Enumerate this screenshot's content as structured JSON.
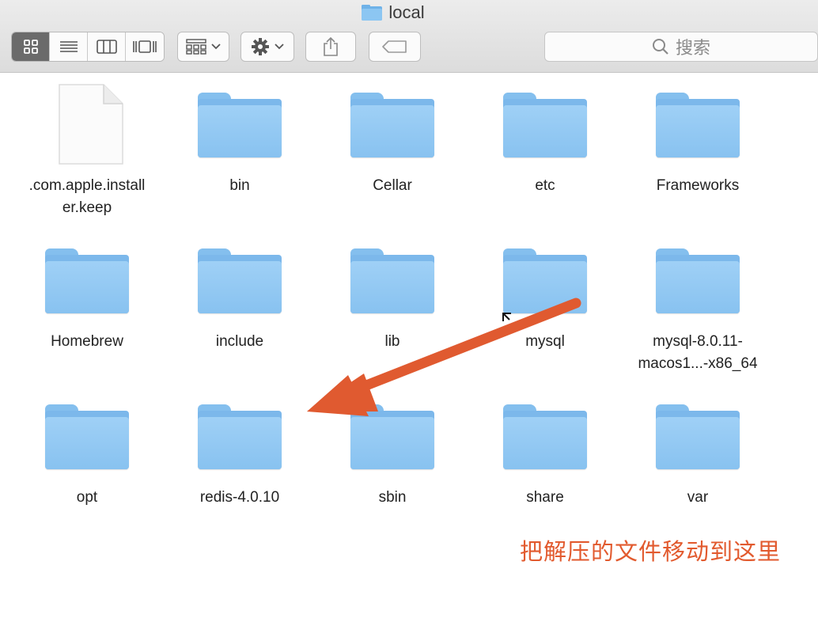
{
  "window": {
    "title": "local",
    "title_icon": "folder-icon"
  },
  "toolbar": {
    "view_modes": [
      {
        "name": "icon-view",
        "icon": "grid-icon",
        "active": true
      },
      {
        "name": "list-view",
        "icon": "list-icon",
        "active": false
      },
      {
        "name": "column-view",
        "icon": "columns-icon",
        "active": false
      },
      {
        "name": "gallery-view",
        "icon": "gallery-icon",
        "active": false
      }
    ],
    "arrange_icon": "arrange-icon",
    "action_icon": "gear-icon",
    "share_icon": "share-icon",
    "tag_icon": "tag-icon",
    "search_placeholder": "搜索"
  },
  "items": [
    {
      "label": ".com.apple.install\ner.keep",
      "type": "document"
    },
    {
      "label": "bin",
      "type": "folder"
    },
    {
      "label": "Cellar",
      "type": "folder"
    },
    {
      "label": "etc",
      "type": "folder"
    },
    {
      "label": "Frameworks",
      "type": "folder"
    },
    {
      "label": "Homebrew",
      "type": "folder"
    },
    {
      "label": "include",
      "type": "folder"
    },
    {
      "label": "lib",
      "type": "folder"
    },
    {
      "label": "mysql",
      "type": "folder"
    },
    {
      "label": "mysql-8.0.11-\nmacos1...-x86_64",
      "type": "folder"
    },
    {
      "label": "opt",
      "type": "folder"
    },
    {
      "label": "redis-4.0.10",
      "type": "folder"
    },
    {
      "label": "sbin",
      "type": "folder"
    },
    {
      "label": "share",
      "type": "folder"
    },
    {
      "label": "var",
      "type": "folder"
    }
  ],
  "annotation": {
    "text": "把解压的文件移动到这里",
    "color": "#e25a2e"
  },
  "colors": {
    "folder": "#88c2f0",
    "arrow": "#e05a30"
  }
}
